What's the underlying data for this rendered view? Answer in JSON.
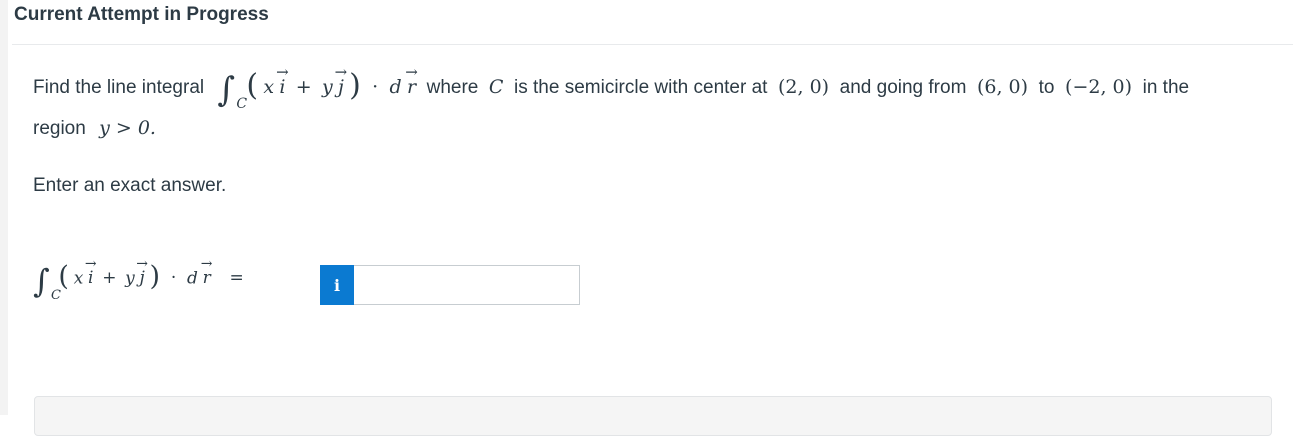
{
  "header": {
    "title": "Current Attempt in Progress"
  },
  "question": {
    "intro": "Find the line integral",
    "int_sub": "C",
    "x_var": "x",
    "i_vec": "i",
    "plus": "+",
    "y_var": "y",
    "j_vec": "j",
    "dot": "·",
    "d_var": "d",
    "r_vec": "r",
    "mid_text": " where ",
    "curve": "C",
    "desc": " is the semicircle with center at ",
    "center": "(2, 0)",
    "going_from": " and going from ",
    "start_point": "(6, 0)",
    "to_word": " to ",
    "end_point": "(−2, 0)",
    "end_text": " in the",
    "region_word": "region",
    "region_cond": "y > 0.",
    "instruction": "Enter an exact answer."
  },
  "answer": {
    "equals": "=",
    "info_label": "i",
    "value": ""
  }
}
